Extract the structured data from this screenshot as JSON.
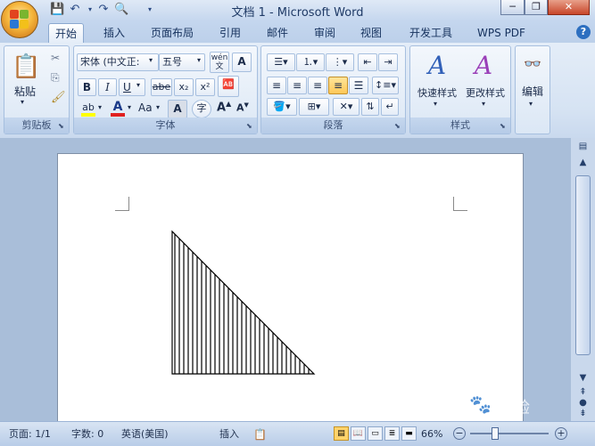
{
  "window": {
    "title": "文档 1 - Microsoft Word",
    "minimize": "─",
    "restore": "❐",
    "close": "✕"
  },
  "quick_access": {
    "save_icon": "save-icon",
    "undo_icon": "undo-icon",
    "redo_icon": "redo-icon",
    "preview_icon": "print-preview-icon"
  },
  "tabs": [
    "开始",
    "插入",
    "页面布局",
    "引用",
    "邮件",
    "审阅",
    "视图",
    "开发工具",
    "WPS PDF"
  ],
  "ribbon": {
    "clipboard": {
      "label": "剪贴板",
      "paste": "粘贴"
    },
    "font": {
      "label": "字体",
      "font_name": "宋体 (中文正:",
      "font_size": "五号",
      "bold": "B",
      "italic": "I",
      "underline": "U",
      "strike": "abe",
      "subscript": "x₂",
      "superscript": "x²",
      "case": "Aa",
      "grow": "A",
      "shrink": "A",
      "wen": "wén\n文",
      "clear_format": "A"
    },
    "paragraph": {
      "label": "段落"
    },
    "styles": {
      "label": "样式",
      "quick_styles": "快速样式",
      "change_styles": "更改样式"
    },
    "editing": {
      "label": "编辑"
    }
  },
  "status": {
    "page": "页面: 1/1",
    "words": "字数: 0",
    "language": "英语(美国)",
    "mode": "插入",
    "zoom": "66%"
  },
  "watermark": {
    "brand": "Bai",
    "suffix": "经验"
  },
  "colors": {
    "ribbon_bg": "#dbe7f5",
    "doc_bg": "#a9bed9",
    "accent_red": "#e02020",
    "highlight_yellow": "#ffff00"
  }
}
